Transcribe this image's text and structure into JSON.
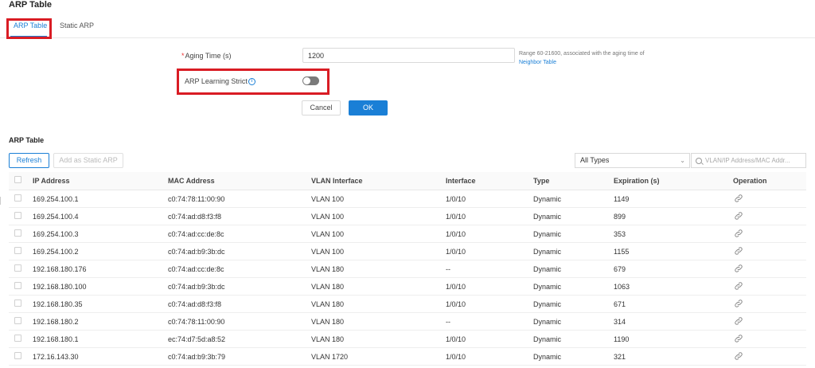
{
  "page": {
    "title": "ARP Table"
  },
  "tabs": [
    {
      "label": "ARP Table"
    },
    {
      "label": "Static ARP"
    }
  ],
  "form": {
    "aging_label": "Aging Time (s)",
    "aging_value": "1200",
    "hint_text": "Range 60-21600, associated with the aging time of",
    "hint_link": "Neighbor Table",
    "learning_label": "ARP Learning Strict",
    "learning_enabled": false,
    "cancel_label": "Cancel",
    "ok_label": "OK"
  },
  "table_section": {
    "title": "ARP Table",
    "refresh_label": "Refresh",
    "add_static_label": "Add as Static ARP",
    "type_filter": "All Types",
    "search_placeholder": "VLAN/IP Address/MAC Addr..."
  },
  "table": {
    "columns": [
      "IP Address",
      "MAC Address",
      "VLAN Interface",
      "Interface",
      "Type",
      "Expiration (s)",
      "Operation"
    ],
    "rows": [
      [
        "169.254.100.1",
        "c0:74:78:11:00:90",
        "VLAN 100",
        "1/0/10",
        "Dynamic",
        "1149"
      ],
      [
        "169.254.100.4",
        "c0:74:ad:d8:f3:f8",
        "VLAN 100",
        "1/0/10",
        "Dynamic",
        "899"
      ],
      [
        "169.254.100.3",
        "c0:74:ad:cc:de:8c",
        "VLAN 100",
        "1/0/10",
        "Dynamic",
        "353"
      ],
      [
        "169.254.100.2",
        "c0:74:ad:b9:3b:dc",
        "VLAN 100",
        "1/0/10",
        "Dynamic",
        "1155"
      ],
      [
        "192.168.180.176",
        "c0:74:ad:cc:de:8c",
        "VLAN 180",
        "--",
        "Dynamic",
        "679"
      ],
      [
        "192.168.180.100",
        "c0:74:ad:b9:3b:dc",
        "VLAN 180",
        "1/0/10",
        "Dynamic",
        "1063"
      ],
      [
        "192.168.180.35",
        "c0:74:ad:d8:f3:f8",
        "VLAN 180",
        "1/0/10",
        "Dynamic",
        "671"
      ],
      [
        "192.168.180.2",
        "c0:74:78:11:00:90",
        "VLAN 180",
        "--",
        "Dynamic",
        "314"
      ],
      [
        "192.168.180.1",
        "ec:74:d7:5d:a8:52",
        "VLAN 180",
        "1/0/10",
        "Dynamic",
        "1190"
      ],
      [
        "172.16.143.30",
        "c0:74:ad:b9:3b:79",
        "VLAN 1720",
        "1/0/10",
        "Dynamic",
        "321"
      ]
    ]
  },
  "colors": {
    "accent": "#1a7fd6",
    "highlight": "#d91c24",
    "toggle_off": "#7a7a7a"
  }
}
